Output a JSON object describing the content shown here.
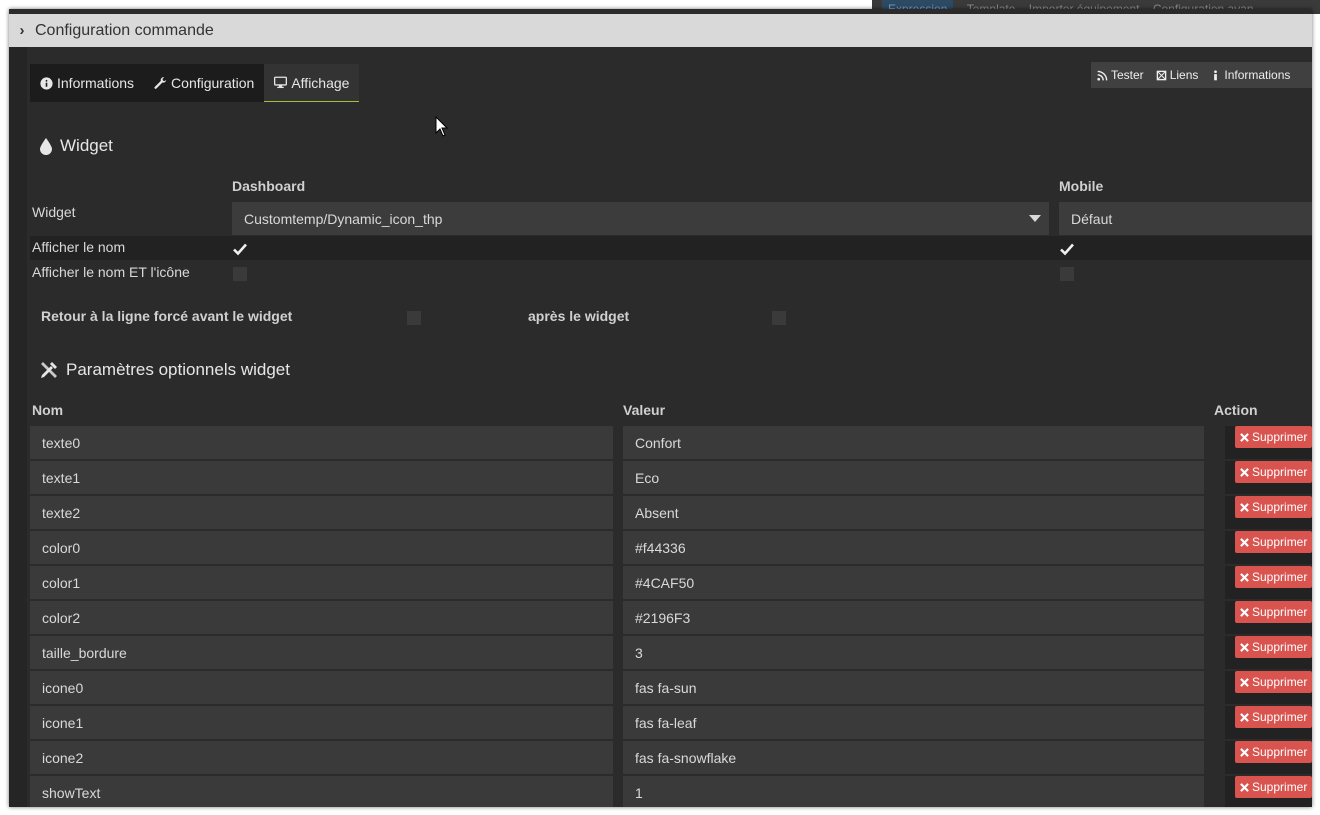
{
  "background_strip": {
    "items": [
      "Expression",
      "Template",
      "Importer équipement",
      "Configuration avan"
    ]
  },
  "dialog": {
    "title": "Configuration commande"
  },
  "tabs": [
    {
      "label": "Informations",
      "icon": "info-circle-icon"
    },
    {
      "label": "Configuration",
      "icon": "wrench-icon"
    },
    {
      "label": "Affichage",
      "icon": "desktop-icon",
      "active": true
    }
  ],
  "actions": {
    "test": "Tester",
    "links": "Liens",
    "info": "Informations"
  },
  "widget_section": {
    "title": "Widget",
    "dashboard_header": "Dashboard",
    "mobile_header": "Mobile",
    "widget_label": "Widget",
    "dashboard_value": "Customtemp/Dynamic_icon_thp",
    "mobile_value": "Défaut",
    "show_name_label": "Afficher le nom",
    "show_name_icon_label": "Afficher le nom ET l'icône",
    "show_name_dashboard": true,
    "show_name_mobile": true,
    "show_name_icon_dashboard": false,
    "show_name_icon_mobile": false,
    "line_break_before_label": "Retour à la ligne forcé avant le widget",
    "line_break_after_label": "après le widget"
  },
  "optional_params": {
    "title": "Paramètres optionnels widget",
    "headers": {
      "name": "Nom",
      "value": "Valeur",
      "action": "Action"
    },
    "delete_label": "Supprimer",
    "rows": [
      {
        "name": "texte0",
        "value": "Confort"
      },
      {
        "name": "texte1",
        "value": "Eco"
      },
      {
        "name": "texte2",
        "value": "Absent"
      },
      {
        "name": "color0",
        "value": "#f44336"
      },
      {
        "name": "color1",
        "value": "#4CAF50"
      },
      {
        "name": "color2",
        "value": "#2196F3"
      },
      {
        "name": "taille_bordure",
        "value": "3"
      },
      {
        "name": "icone0",
        "value": "fas fa-sun"
      },
      {
        "name": "icone1",
        "value": "fas fa-leaf"
      },
      {
        "name": "icone2",
        "value": "fas fa-snowflake"
      },
      {
        "name": "showText",
        "value": "1"
      }
    ]
  },
  "colors": {
    "panel_bg": "#2b2b2b",
    "field_bg": "#3a3a3a",
    "delete_red": "#d9534f",
    "active_tab_underline": "#9fc13a"
  }
}
